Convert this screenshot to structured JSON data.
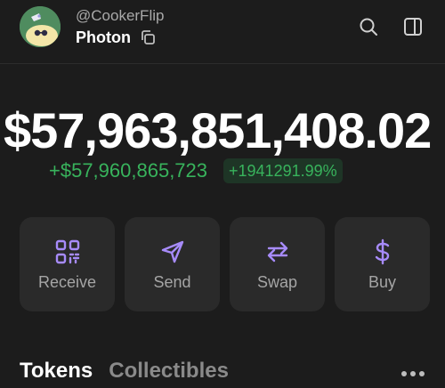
{
  "header": {
    "username": "@CookerFlip",
    "wallet_name": "Photon"
  },
  "balance": {
    "total": "$57,963,851,408.02",
    "change_amount": "+$57,960,865,723",
    "change_percent": "+1941291.99%"
  },
  "actions": [
    {
      "label": "Receive",
      "icon": "qr-code-icon"
    },
    {
      "label": "Send",
      "icon": "send-icon"
    },
    {
      "label": "Swap",
      "icon": "swap-icon"
    },
    {
      "label": "Buy",
      "icon": "dollar-icon"
    }
  ],
  "tabs": [
    {
      "label": "Tokens",
      "active": true
    },
    {
      "label": "Collectibles",
      "active": false
    }
  ],
  "colors": {
    "background": "#1c1c1c",
    "card": "#2a2a2a",
    "positive": "#38b35c",
    "accent_purple": "#a78bfa"
  }
}
